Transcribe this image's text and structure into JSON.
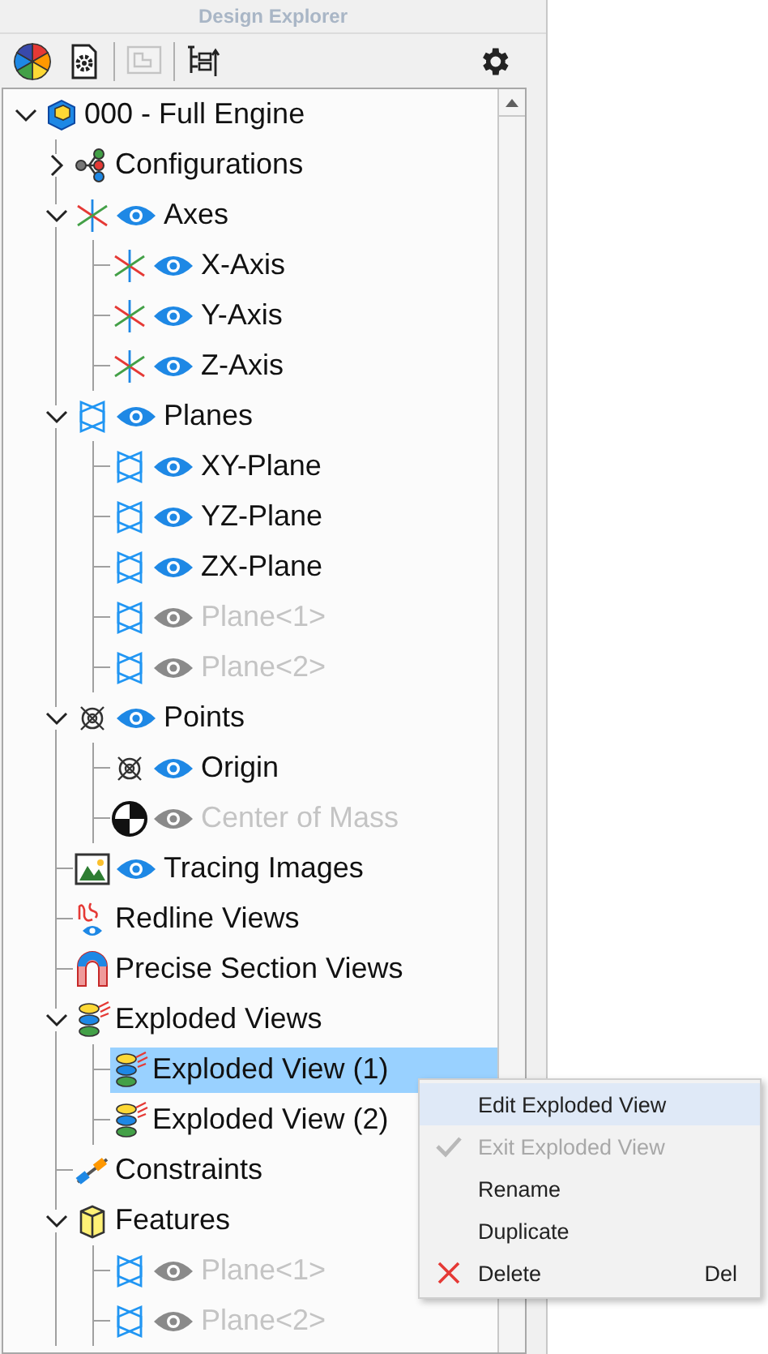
{
  "panel": {
    "title": "Design Explorer"
  },
  "toolbar": [
    {
      "kind": "appearance",
      "disabled": false
    },
    {
      "kind": "document-settings",
      "disabled": false
    },
    {
      "kind": "sketch",
      "disabled": true
    },
    {
      "kind": "tree-options",
      "disabled": false
    },
    {
      "kind": "settings",
      "disabled": false
    }
  ],
  "tree": [
    {
      "label": "000 - Full Engine",
      "kind": "assembly",
      "expanded": true,
      "selected": false,
      "children": [
        {
          "label": "Configurations",
          "kind": "configurations",
          "expanded": false,
          "selected": false
        },
        {
          "label": "Axes",
          "kind": "axis",
          "visible": true,
          "expanded": true,
          "selected": false,
          "children": [
            {
              "label": "X-Axis",
              "kind": "axis",
              "visible": true,
              "selected": false
            },
            {
              "label": "Y-Axis",
              "kind": "axis",
              "visible": true,
              "selected": false
            },
            {
              "label": "Z-Axis",
              "kind": "axis",
              "visible": true,
              "selected": false
            }
          ]
        },
        {
          "label": "Planes",
          "kind": "plane",
          "visible": true,
          "expanded": true,
          "selected": false,
          "children": [
            {
              "label": "XY-Plane",
              "kind": "plane",
              "visible": true,
              "selected": false
            },
            {
              "label": "YZ-Plane",
              "kind": "plane",
              "visible": true,
              "selected": false
            },
            {
              "label": "ZX-Plane",
              "kind": "plane",
              "visible": true,
              "selected": false
            },
            {
              "label": "Plane<1>",
              "kind": "plane",
              "visible": false,
              "selected": false
            },
            {
              "label": "Plane<2>",
              "kind": "plane",
              "visible": false,
              "selected": false
            }
          ]
        },
        {
          "label": "Points",
          "kind": "point",
          "visible": true,
          "expanded": true,
          "selected": false,
          "children": [
            {
              "label": "Origin",
              "kind": "point",
              "visible": true,
              "selected": false
            },
            {
              "label": "Center of Mass",
              "kind": "mass",
              "visible": false,
              "selected": false
            }
          ]
        },
        {
          "label": "Tracing Images",
          "kind": "image",
          "visible": true,
          "selected": false
        },
        {
          "label": "Redline Views",
          "kind": "redline",
          "selected": false
        },
        {
          "label": "Precise Section Views",
          "kind": "section",
          "selected": false
        },
        {
          "label": "Exploded Views",
          "kind": "exploded",
          "expanded": true,
          "selected": false,
          "children": [
            {
              "label": "Exploded View (1)",
              "kind": "exploded",
              "selected": true
            },
            {
              "label": "Exploded View (2)",
              "kind": "exploded",
              "selected": false
            }
          ]
        },
        {
          "label": "Constraints",
          "kind": "constraints",
          "selected": false
        },
        {
          "label": "Features",
          "kind": "feature",
          "expanded": true,
          "selected": false,
          "children": [
            {
              "label": "Plane<1>",
              "kind": "plane",
              "visible": false,
              "selected": false
            },
            {
              "label": "Plane<2>",
              "kind": "plane",
              "visible": false,
              "selected": false
            }
          ]
        }
      ]
    }
  ],
  "context_menu": [
    {
      "label": "Edit Exploded View",
      "selected": true,
      "disabled": false
    },
    {
      "label": "Exit Exploded View",
      "kind": "check",
      "selected": false,
      "disabled": true
    },
    {
      "label": "Rename",
      "selected": false,
      "disabled": false
    },
    {
      "label": "Duplicate",
      "selected": false,
      "disabled": false
    },
    {
      "label": "Delete",
      "kind": "delete",
      "shortcut": "Del",
      "selected": false,
      "disabled": false
    }
  ]
}
